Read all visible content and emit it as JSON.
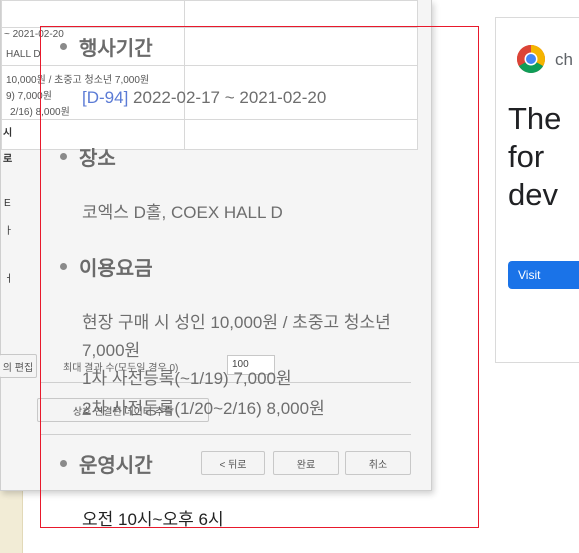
{
  "background_dialog": {
    "table_cells": {
      "date": "~ 2021-02-20",
      "hall": "HALL D",
      "fee": "10,000원 / 초중고 청소년 7,000원",
      "pre1": "9) 7,000원",
      "pre2": "2/16) 8,000원",
      "side_c1": "시",
      "side_c2": "로",
      "side_c3": "E",
      "side_c4": "ㅏ",
      "side_c5": "ㅓ"
    },
    "edit_label": "의 편집",
    "max_results_label": "최대 결과 수(모두일 경우 0)",
    "max_results_value": "100",
    "mutual_button": "상호 연결된 데이터 추출",
    "back_button": "< 뒤로",
    "done_button": "완료",
    "cancel_button": "취소"
  },
  "event": {
    "period_heading": "행사기간",
    "dday": "[D-94]",
    "period": "2022-02-17 ~ 2021-02-20",
    "place_heading": "장소",
    "place": "코엑스 D홀, COEX HALL D",
    "fee_heading": "이용요금",
    "fee_line1": "현장 구매 시 성인 10,000원 / 초중고 청소년",
    "fee_line2": "7,000원",
    "fee_line3": "1차 사전등록(~1/19) 7,000원",
    "fee_line4": "2차 사전등록(1/20~2/16) 8,000원",
    "hours_heading": "운영시간",
    "hours": "오전 10시~오후 6시"
  },
  "ad": {
    "brand": "ch",
    "headline": "The\nfor\ndev",
    "button": "Visit"
  },
  "colors": {
    "selection": "#e8192c",
    "dday": "#5b7bd5",
    "ad_button": "#1a73e8"
  }
}
